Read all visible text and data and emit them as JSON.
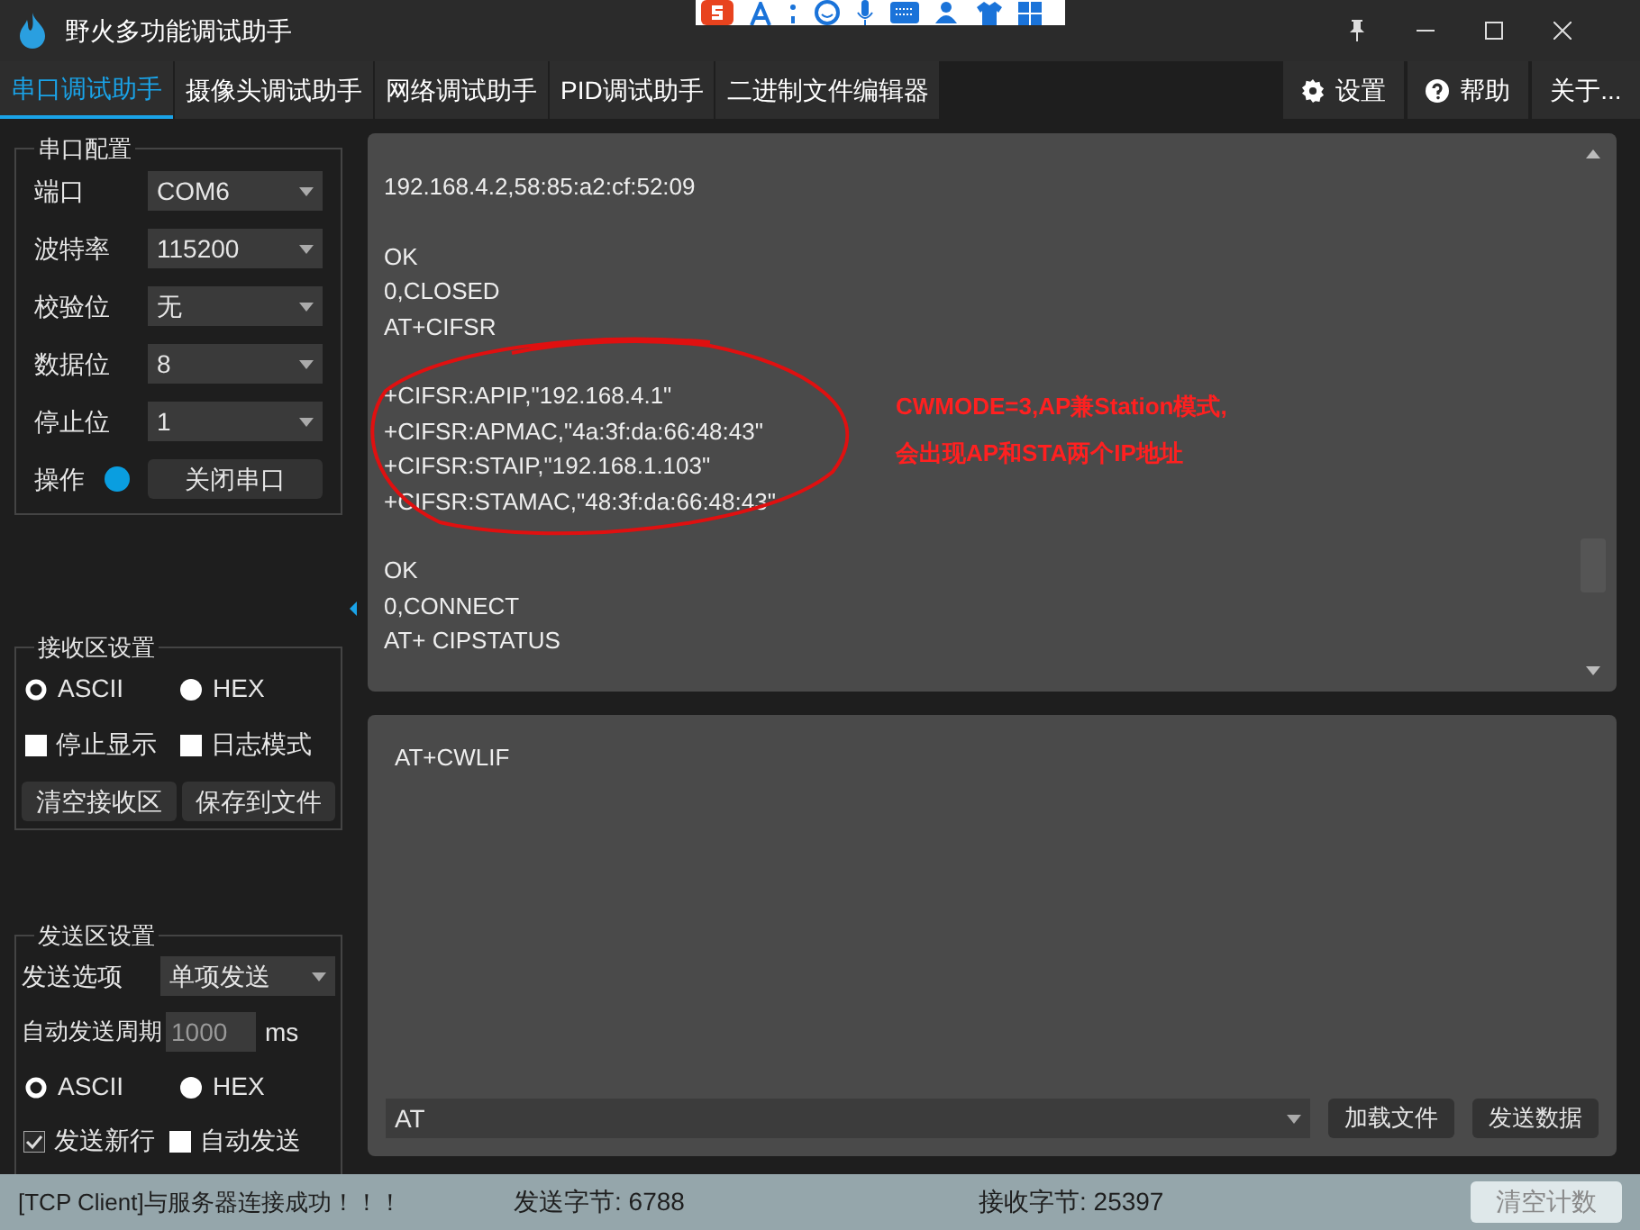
{
  "window": {
    "title": "野火多功能调试助手"
  },
  "tabs": [
    {
      "label": "串口调试助手",
      "selected": true
    },
    {
      "label": "摄像头调试助手",
      "selected": false
    },
    {
      "label": "网络调试助手",
      "selected": false
    },
    {
      "label": "PID调试助手",
      "selected": false
    },
    {
      "label": "二进制文件编辑器",
      "selected": false
    }
  ],
  "toolbar_buttons": [
    {
      "label": "设置",
      "kind": "settings"
    },
    {
      "label": "帮助",
      "kind": "help"
    },
    {
      "label": "关于...",
      "kind": "plain"
    }
  ],
  "serial_config": {
    "title": "串口配置",
    "fields": [
      {
        "label": "端口",
        "value": "COM6"
      },
      {
        "label": "波特率",
        "value": "115200"
      },
      {
        "label": "校验位",
        "value": "无"
      },
      {
        "label": "数据位",
        "value": "8"
      },
      {
        "label": "停止位",
        "value": "1"
      }
    ],
    "operation_label": "操作",
    "port_open": true,
    "close_button": "关闭串口"
  },
  "receive_settings": {
    "title": "接收区设置",
    "modes": [
      {
        "label": "ASCII",
        "selected": true
      },
      {
        "label": "HEX",
        "selected": false
      }
    ],
    "options": [
      {
        "label": "停止显示",
        "checked": false
      },
      {
        "label": "日志模式",
        "checked": false
      }
    ],
    "buttons": [
      "清空接收区",
      "保存到文件"
    ]
  },
  "send_settings": {
    "title": "发送区设置",
    "option_label": "发送选项",
    "option_value": "单项发送",
    "period_label": "自动发送周期",
    "period_value": "1000",
    "period_unit": "ms",
    "modes": [
      {
        "label": "ASCII",
        "selected": true
      },
      {
        "label": "HEX",
        "selected": false
      }
    ],
    "options": [
      {
        "label": "发送新行",
        "checked": true
      },
      {
        "label": "自动发送",
        "checked": false
      }
    ]
  },
  "receive_log": [
    {
      "text": "192.168.4.2,58:85:a2:cf:52:09",
      "blank_before": false
    },
    {
      "text": "OK",
      "blank_before": true
    },
    {
      "text": "0,CLOSED",
      "blank_before": false
    },
    {
      "text": "AT+CIFSR",
      "blank_before": false
    },
    {
      "text": "+CIFSR:APIP,\"192.168.4.1\"",
      "blank_before": true
    },
    {
      "text": "+CIFSR:APMAC,\"4a:3f:da:66:48:43\"",
      "blank_before": false
    },
    {
      "text": "+CIFSR:STAIP,\"192.168.1.103\"",
      "blank_before": false
    },
    {
      "text": "+CIFSR:STAMAC,\"48:3f:da:66:48:43\"",
      "blank_before": false
    },
    {
      "text": "OK",
      "blank_before": true
    },
    {
      "text": "0,CONNECT",
      "blank_before": false
    },
    {
      "text": "AT+ CIPSTATUS",
      "blank_before": false
    }
  ],
  "annotation": [
    "CWMODE=3,AP兼Station模式,",
    "会出现AP和STA两个IP地址"
  ],
  "send_text": "AT+CWLIF",
  "command_value": "AT",
  "send_buttons": [
    "加载文件",
    "发送数据"
  ],
  "status_bar": {
    "message": "[TCP Client]与服务器连接成功！！！",
    "sent": "发送字节: 6788",
    "received": "接收字节: 25397",
    "clear_button": "清空计数"
  }
}
